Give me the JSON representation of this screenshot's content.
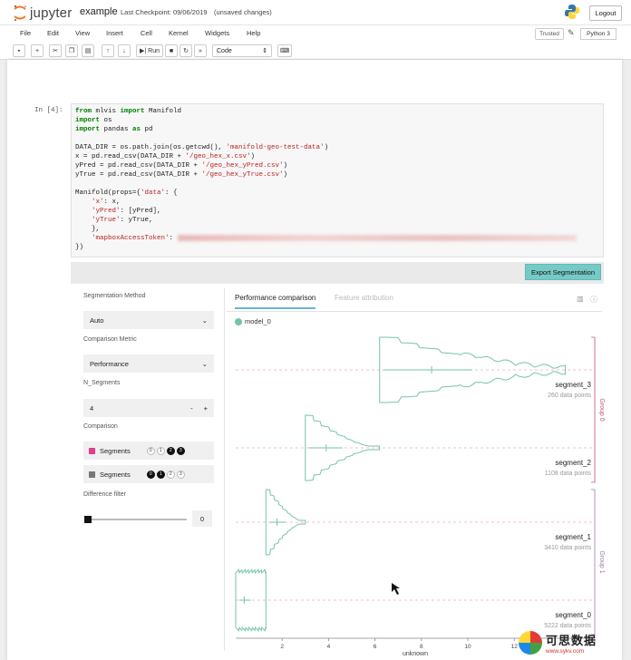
{
  "header": {
    "logo_text": "jupyter",
    "notebook_name": "example",
    "checkpoint": "Last Checkpoint: 09/06/2019",
    "unsaved": "(unsaved changes)",
    "logout_label": "Logout"
  },
  "menu": {
    "items": [
      "File",
      "Edit",
      "View",
      "Insert",
      "Cell",
      "Kernel",
      "Widgets",
      "Help"
    ],
    "trusted_label": "Trusted",
    "kernel_label": "Python 3"
  },
  "toolbar": {
    "run_label": "Run",
    "cell_type": "Code"
  },
  "cell": {
    "prompt": "In [4]:"
  },
  "widget": {
    "export_label": "Export Segmentation",
    "controls": {
      "method_label": "Segmentation Method",
      "method_value": "Auto",
      "metric_label": "Comparison Metric",
      "metric_value": "Performance",
      "nseg_label": "N_Segments",
      "nseg_value": "4",
      "nseg_minus": "-",
      "nseg_plus": "+",
      "comparison_label": "Comparison",
      "segments_label": "Segments",
      "row1_chips": [
        "0",
        "1",
        "2",
        "3"
      ],
      "row2_chips": [
        "0",
        "1",
        "2",
        "3"
      ],
      "difference_label": "Difference filter",
      "difference_value": "0",
      "row1_color": "#e0408c",
      "row2_color": "#777777"
    },
    "tabs": {
      "active": "Performance comparison",
      "inactive": "Feature attribution"
    },
    "legend_label": "model_0",
    "accent": "#76c2ae"
  },
  "chart_data": {
    "type": "violin",
    "xlabel": "unknown",
    "x_ticks": [
      "2",
      "4",
      "6",
      "8",
      "10",
      "12"
    ],
    "series": [
      {
        "name": "segment_3",
        "count_label": "260 data points",
        "range": [
          6.2,
          14.2
        ],
        "group": "Group 0"
      },
      {
        "name": "segment_2",
        "count_label": "1108 data points",
        "range": [
          3.0,
          6.2
        ],
        "group": "Group 0"
      },
      {
        "name": "segment_1",
        "count_label": "3410 data points",
        "range": [
          1.3,
          3.0
        ],
        "group": "Group 1"
      },
      {
        "name": "segment_0",
        "count_label": "5222 data points",
        "range": [
          0.0,
          1.3
        ],
        "group": "Group 1"
      }
    ],
    "groups": [
      {
        "name": "Group 0",
        "color": "#c0507a"
      },
      {
        "name": "Group 1",
        "color": "#9e7aa8"
      }
    ]
  },
  "watermark": {
    "cn": "可思数据",
    "url": "www.sykv.com"
  }
}
